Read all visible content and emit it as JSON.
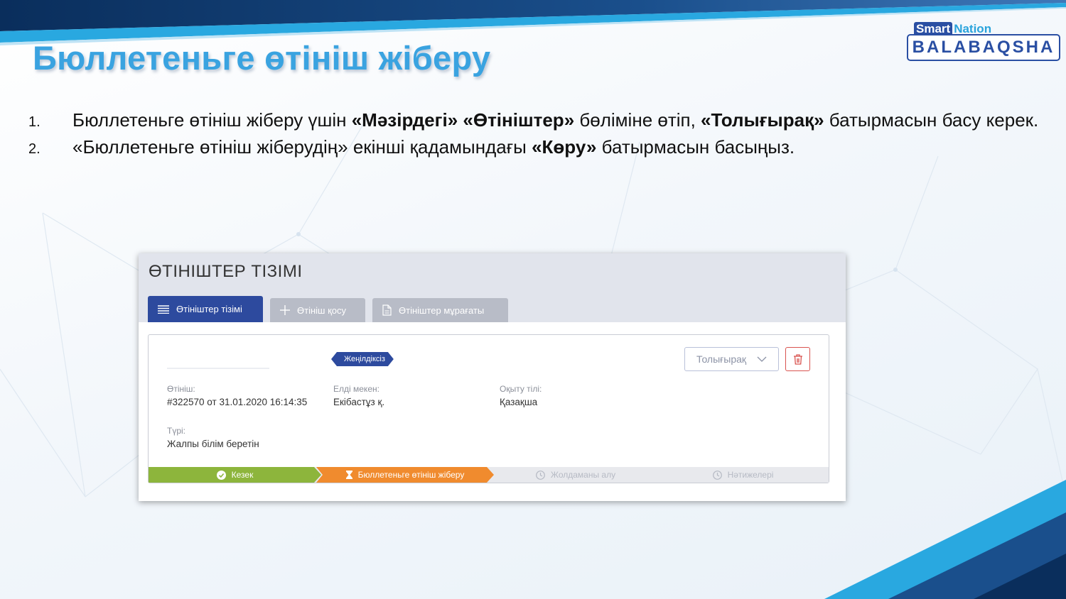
{
  "slide": {
    "title": "Бюллетеньге өтініш жіберу",
    "logo": {
      "smart": "Smart",
      "nation": "Nation",
      "brand": "BALABAQSHA"
    },
    "steps": [
      {
        "num": "1.",
        "parts": [
          "Бюллетеньге өтініш жіберу үшін ",
          "«Мәзірдегі» «Өтініштер»",
          " бөліміне өтіп, ",
          "«Толығырақ»",
          " батырмасын басу керек."
        ]
      },
      {
        "num": "2.",
        "parts": [
          "«Бюллетеньге өтініш жіберудің» екінші қадамындағы ",
          "«Көру»",
          " батырмасын басыңыз."
        ]
      }
    ]
  },
  "app": {
    "title": "ӨТІНІШТЕР ТІЗІМІ",
    "tabs": [
      {
        "label": "Өтініштер тізімі",
        "icon": "list-icon",
        "active": true
      },
      {
        "label": "Өтініш қосу",
        "icon": "plus-icon",
        "active": false
      },
      {
        "label": "Өтініштер мұрағаты",
        "icon": "document-icon",
        "active": false
      }
    ],
    "card": {
      "badge": "Жеңілдіксіз",
      "more_button": "Толығырақ",
      "fields": {
        "application": {
          "label": "Өтініш:",
          "value": "#322570 от 31.01.2020 16:14:35"
        },
        "locality": {
          "label": "Елді мекен:",
          "value": "Екібастұз қ."
        },
        "language": {
          "label": "Оқыту тілі:",
          "value": "Қазақша"
        },
        "type": {
          "label": "Түрі:",
          "value": "Жалпы білім беретін"
        }
      },
      "progress": [
        {
          "label": "Кезек",
          "state": "done",
          "icon": "check-circle-icon"
        },
        {
          "label": "Бюллетеньге өтініш жіберу",
          "state": "current",
          "icon": "hourglass-icon"
        },
        {
          "label": "Жолдаманы алу",
          "state": "pending",
          "icon": "clock-icon"
        },
        {
          "label": "Нәтижелері",
          "state": "pending",
          "icon": "clock-icon"
        }
      ]
    }
  },
  "colors": {
    "title": "#3aa3e0",
    "primary": "#2d4a9e",
    "done": "#8db53c",
    "current": "#f08b2e",
    "danger": "#d9534f"
  }
}
